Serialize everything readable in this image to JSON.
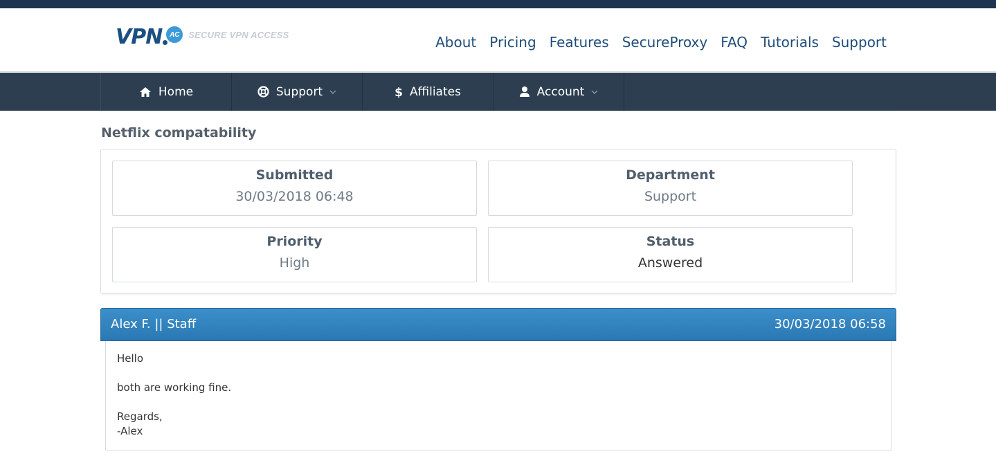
{
  "brand": {
    "logo_text": "VPN",
    "logo_badge": "AC",
    "tagline": "SECURE VPN ACCESS",
    "colors": {
      "primary": "#1b4f82",
      "accent": "#3d9ad8",
      "navbar": "#2c3e50"
    }
  },
  "top_nav": [
    "About",
    "Pricing",
    "Features",
    "SecureProxy",
    "FAQ",
    "Tutorials",
    "Support"
  ],
  "main_nav": {
    "home": {
      "label": "Home",
      "icon": "home-icon"
    },
    "support": {
      "label": "Support",
      "icon": "lifebuoy-icon"
    },
    "affiliates": {
      "label": "Affiliates",
      "icon": "dollar-icon"
    },
    "account": {
      "label": "Account",
      "icon": "user-icon"
    }
  },
  "ticket": {
    "subject": "Netflix compatability",
    "submitted_label": "Submitted",
    "submitted_value": "30/03/2018 06:48",
    "department_label": "Department",
    "department_value": "Support",
    "priority_label": "Priority",
    "priority_value": "High",
    "status_label": "Status",
    "status_value": "Answered"
  },
  "reply": {
    "author": "Alex F. || Staff",
    "date": "30/03/2018 06:58",
    "lines": [
      "Hello",
      "both are working fine.",
      "Regards,",
      "-Alex"
    ]
  }
}
